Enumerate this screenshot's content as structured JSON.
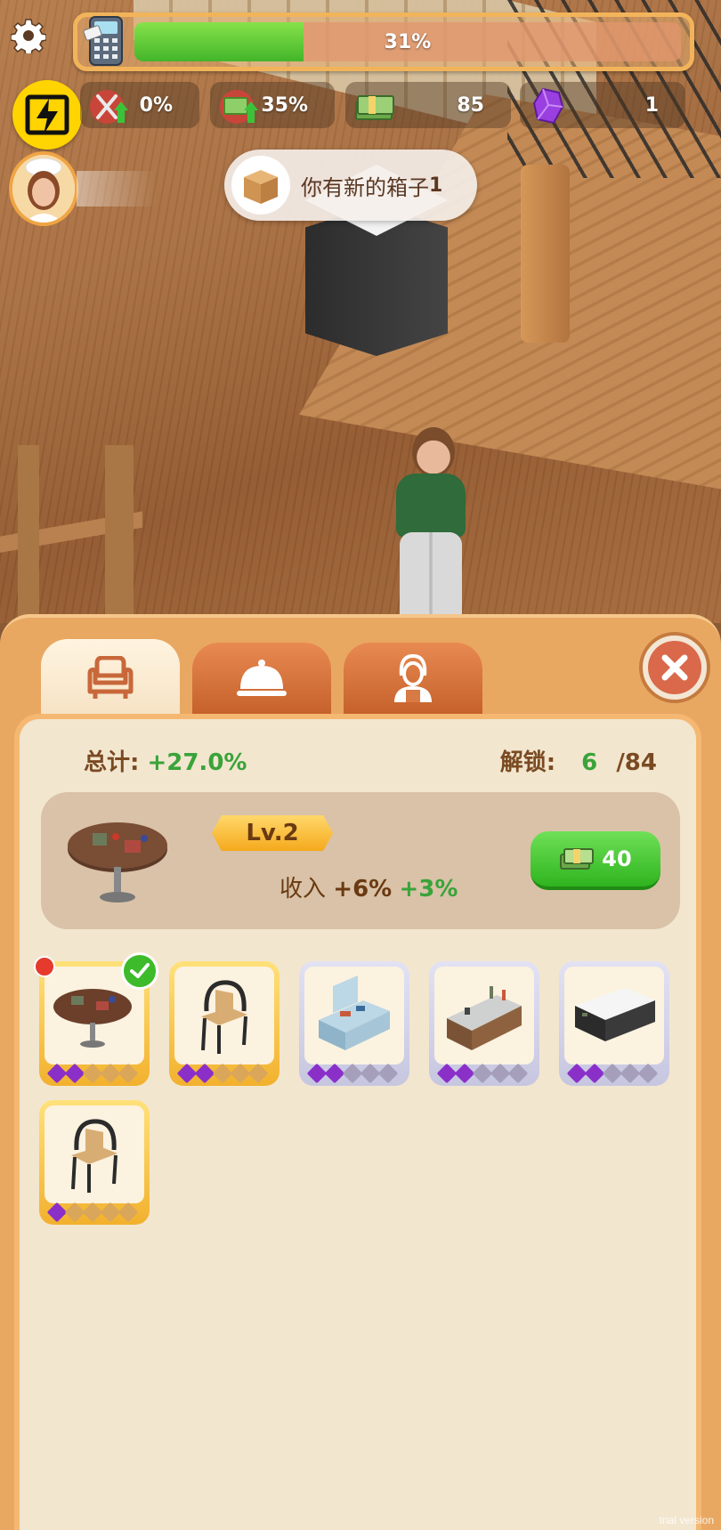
{
  "hud": {
    "progress_label": "31%",
    "progress_value": 0.31,
    "stats": [
      {
        "icon": "utensils-boost-icon",
        "value": "0%"
      },
      {
        "icon": "money-boost-icon",
        "value": "35%"
      },
      {
        "icon": "cash-stack-icon",
        "value": "85"
      },
      {
        "icon": "purple-gem-icon",
        "value": "1"
      }
    ]
  },
  "toast": {
    "message": "你有新的箱子",
    "count": "1"
  },
  "panel": {
    "tabs": [
      {
        "icon": "armchair-icon",
        "active": true
      },
      {
        "icon": "cloche-icon",
        "active": false
      },
      {
        "icon": "staff-icon",
        "active": false
      }
    ],
    "summary": {
      "total_label": "总计:",
      "total_value": "+27.0%",
      "unlock_label": "解锁:",
      "unlock_current": "6",
      "unlock_total": "/84"
    },
    "selected_item": {
      "level": "Lv.2",
      "income_label": "收入",
      "income_base": "+6%",
      "income_bonus": "+3%",
      "upgrade_cost": "40"
    },
    "items": [
      {
        "name": "table",
        "tier": "gold",
        "stars_on": 2,
        "stars_total": 5,
        "new": true,
        "selected": true
      },
      {
        "name": "chair",
        "tier": "gold",
        "stars_on": 2,
        "stars_total": 5,
        "new": false,
        "selected": false
      },
      {
        "name": "kitchen-counter",
        "tier": "silver",
        "stars_on": 2,
        "stars_total": 5,
        "new": false,
        "selected": false
      },
      {
        "name": "bar-counter",
        "tier": "silver",
        "stars_on": 2,
        "stars_total": 5,
        "new": false,
        "selected": false
      },
      {
        "name": "cabinet",
        "tier": "silver",
        "stars_on": 2,
        "stars_total": 5,
        "new": false,
        "selected": false
      },
      {
        "name": "chair",
        "tier": "gold",
        "stars_on": 1,
        "stars_total": 5,
        "new": false,
        "selected": false
      }
    ]
  },
  "watermark": "trial version",
  "colors": {
    "accent_green": "#3aa33a",
    "panel_orange": "#e9a862",
    "content_bg": "#f2e6cf",
    "star_purple": "#8b2fc9"
  }
}
